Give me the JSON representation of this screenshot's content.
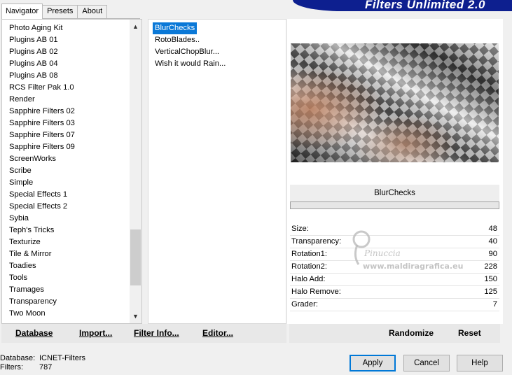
{
  "tabs": [
    "Navigator",
    "Presets",
    "About"
  ],
  "banner": "Filters Unlimited 2.0",
  "categories": [
    "Photo Aging Kit",
    "Plugins AB 01",
    "Plugins AB 02",
    "Plugins AB 04",
    "Plugins AB 08",
    "RCS Filter Pak 1.0",
    "Render",
    "Sapphire Filters 02",
    "Sapphire Filters 03",
    "Sapphire Filters 07",
    "Sapphire Filters 09",
    "ScreenWorks",
    "Scribe",
    "Simple",
    "Special Effects 1",
    "Special Effects 2",
    "Sybia",
    "Teph's Tricks",
    "Texturize",
    "Tile & Mirror",
    "Toadies",
    "Tools",
    "Tramages",
    "Transparency",
    "Two Moon"
  ],
  "filters": [
    "BlurChecks",
    "RotoBlades..",
    "VerticalChopBlur...",
    "Wish it would Rain..."
  ],
  "selected_filter": "BlurChecks",
  "params": [
    {
      "label": "Size:",
      "value": "48"
    },
    {
      "label": "Transparency:",
      "value": "40"
    },
    {
      "label": "Rotation1:",
      "value": "90"
    },
    {
      "label": "Rotation2:",
      "value": "228"
    },
    {
      "label": "Halo Add:",
      "value": "150"
    },
    {
      "label": "Halo Remove:",
      "value": "125"
    },
    {
      "label": "Grader:",
      "value": "7"
    }
  ],
  "watermark": {
    "name": "Pinuccia",
    "site": "www.maldiragrafica.eu"
  },
  "commands": {
    "database": "Database",
    "import": "Import...",
    "filter_info": "Filter Info...",
    "editor": "Editor...",
    "randomize": "Randomize",
    "reset": "Reset"
  },
  "status": {
    "database_label": "Database:",
    "database_value": "ICNET-Filters",
    "filters_label": "Filters:",
    "filters_value": "787"
  },
  "buttons": {
    "apply": "Apply",
    "cancel": "Cancel",
    "help": "Help"
  },
  "colors": {
    "banner": "#0d1f8f",
    "selection": "#0a78d7",
    "default_button_border": "#0078d7"
  }
}
